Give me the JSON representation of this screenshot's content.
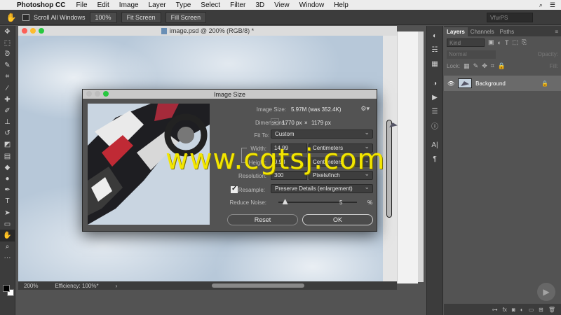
{
  "menubar": {
    "app_name": "Photoshop CC",
    "items": [
      "File",
      "Edit",
      "Image",
      "Layer",
      "Type",
      "Select",
      "Filter",
      "3D",
      "View",
      "Window",
      "Help"
    ]
  },
  "options_bar": {
    "scroll_all_label": "Scroll All Windows",
    "scroll_all_checked": false,
    "zoom_button": "100%",
    "fit_screen_button": "Fit Screen",
    "fill_screen_button": "Fill Screen",
    "workspace_text": "VfurPS"
  },
  "document": {
    "title": "image.psd @ 200% (RGB/8) *",
    "zoom": "200%",
    "efficiency": "Efficiency: 100%*"
  },
  "dialog": {
    "title": "Image Size",
    "image_size_label": "Image Size:",
    "image_size_value": "5.97M (was 352.4K)",
    "dimensions_label": "Dimensions:",
    "dim_width": "1770 px",
    "dim_x": "×",
    "dim_height": "1179 px",
    "fit_to_label": "Fit To:",
    "fit_to_value": "Custom",
    "width_label": "Width:",
    "width_value": "14.99",
    "width_unit": "Centimeters",
    "height_label": "Height:",
    "height_value": "9.98",
    "height_unit": "Centimeters",
    "resolution_label": "Resolution:",
    "resolution_value": "300",
    "resolution_unit": "Pixels/Inch",
    "resample_label": "Resample:",
    "resample_checked": true,
    "resample_value": "Preserve Details (enlargement)",
    "reduce_noise_label": "Reduce Noise:",
    "reduce_noise_value": "5",
    "reduce_noise_unit": "%",
    "reduce_noise_level": 0.05,
    "reset_button": "Reset",
    "ok_button": "OK"
  },
  "watermark": "www.cgtsj.com",
  "layers_panel": {
    "tabs": [
      "Layers",
      "Channels",
      "Paths"
    ],
    "active_tab": "Layers",
    "kind_placeholder": "Kind",
    "blend_mode": "Normal",
    "opacity_label": "Opacity:",
    "lock_label": "Lock:",
    "fill_label": "Fill:",
    "layers": [
      {
        "name": "Background",
        "visible": true,
        "locked": true
      }
    ]
  },
  "colors": {
    "app_bg": "#535353",
    "panel_dark": "#3c3c3c",
    "watermark": "#f3e600"
  },
  "icons": [
    "apple-icon",
    "hand-tool-icon",
    "eye-icon",
    "lock-icon",
    "gear-icon",
    "chain-link-icon",
    "fx-icon",
    "trash-icon",
    "play-icon"
  ]
}
